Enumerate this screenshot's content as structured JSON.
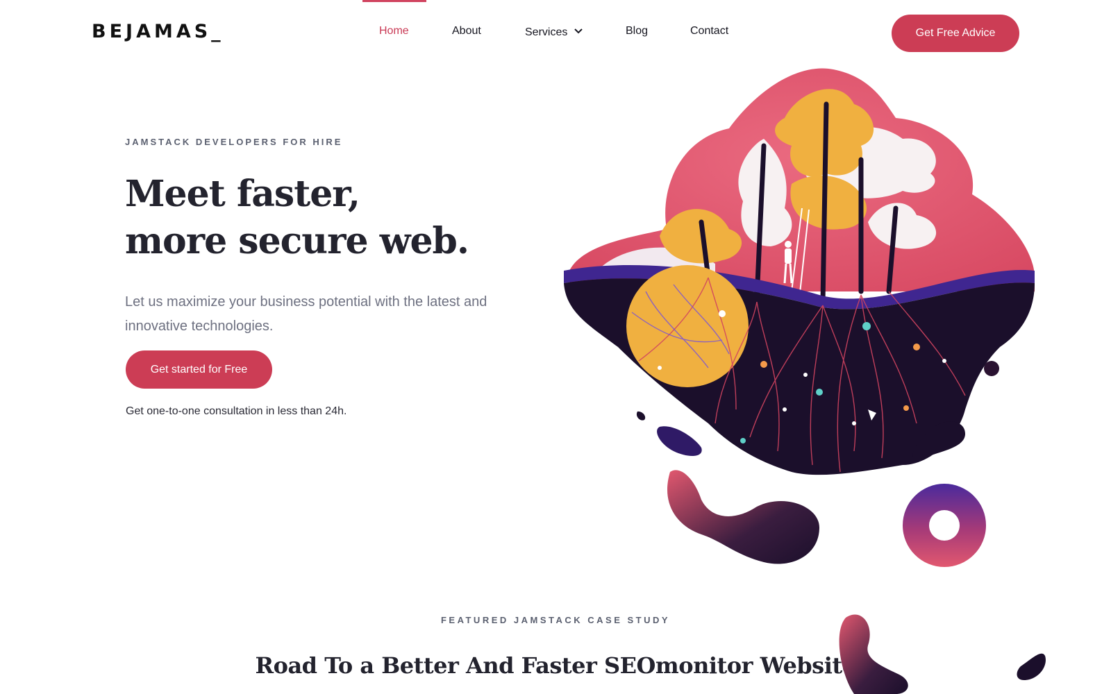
{
  "header": {
    "logo": "BEJAMAS_",
    "nav": [
      {
        "label": "Home",
        "active": true
      },
      {
        "label": "About"
      },
      {
        "label": "Services"
      },
      {
        "label": "Blog"
      },
      {
        "label": "Contact"
      }
    ],
    "cta_label": "Get Free Advice"
  },
  "hero": {
    "eyebrow": "JAMSTACK DEVELOPERS FOR HIRE",
    "title_line1": "Meet faster,",
    "title_line2": "more secure web.",
    "subtitle": "Let us maximize your business potential with the latest and innovative technologies.",
    "cta_label": "Get started for Free",
    "note": "Get one-to-one consultation in less than 24h."
  },
  "featured": {
    "eyebrow": "FEATURED JAMSTACK CASE STUDY",
    "title": "Road To a Better And Faster SEOmonitor Website"
  },
  "colors": {
    "accent": "#cc3d55",
    "dark": "#1b0f2b",
    "purple": "#4a2a9c",
    "yellow": "#f0b040",
    "pink": "#e2586f"
  }
}
